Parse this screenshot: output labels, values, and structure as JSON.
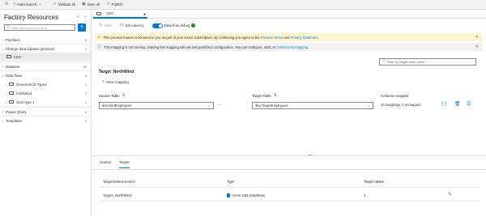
{
  "topbar": {
    "branch_label": "main branch",
    "validate_label": "Validate all",
    "save_label": "Save all",
    "publish_label": "Publish"
  },
  "left_panel": {
    "title": "Factory Resources",
    "filter_placeholder": "Filter resources by name",
    "items": [
      {
        "label": "Pipelines",
        "count": "5"
      },
      {
        "label": "Change data capture (preview)",
        "count": "1"
      },
      {
        "label": "CDC",
        "count": ""
      },
      {
        "label": "Datasets",
        "count": "39"
      },
      {
        "label": "Data flows",
        "count": "4"
      },
      {
        "label": "GenericSCD Type2",
        "count": "1"
      },
      {
        "label": "northwind",
        "count": "2"
      },
      {
        "label": "SCD type 1",
        "count": "1"
      },
      {
        "label": "Power Query",
        "count": "0"
      },
      {
        "label": "Templates",
        "count": "0"
      }
    ]
  },
  "tab": {
    "label": "CDC"
  },
  "toolbar": {
    "start_label": "Start",
    "latency_label": "Set Latency",
    "debug_label": "Data flow debug"
  },
  "banners": {
    "warning_prefix": "This preview feature is licensed to you as part of your Azure subscription. By continuing you agree to the",
    "warning_link1": "Preview Terms",
    "warning_and": "and",
    "warning_link2": "Privacy Statement",
    "info_prefix": "This mapping is not running. Starting this mapping will use last published configuration. You can configure, start, or",
    "info_link": "monitor this mapping."
  },
  "mapping": {
    "filter_placeholder": "Filter by target table name",
    "title": "Target_NorthWind",
    "new_mapping_label": "New mapping",
    "source_table_header": "Source Table",
    "target_table_header": "Target Table",
    "columns_mapped_header": "Columns mapped",
    "source_value": "dbo.DimEmployees",
    "target_value": "dbo.TargetEmployees",
    "columns_mapped_value": "23 mappings; 0 unmapped"
  },
  "bottom": {
    "tabs": [
      "Source",
      "Target"
    ],
    "active_tab": "Target",
    "headers": [
      "Target linked service",
      "Type",
      "Target tables"
    ],
    "row": {
      "service": "Target_NorthWind",
      "type": "Azure SQL Database",
      "tables": "1"
    }
  },
  "colors": {
    "accent": "#0078d4",
    "warning_bg": "#fff4ce",
    "success": "#107c10"
  }
}
